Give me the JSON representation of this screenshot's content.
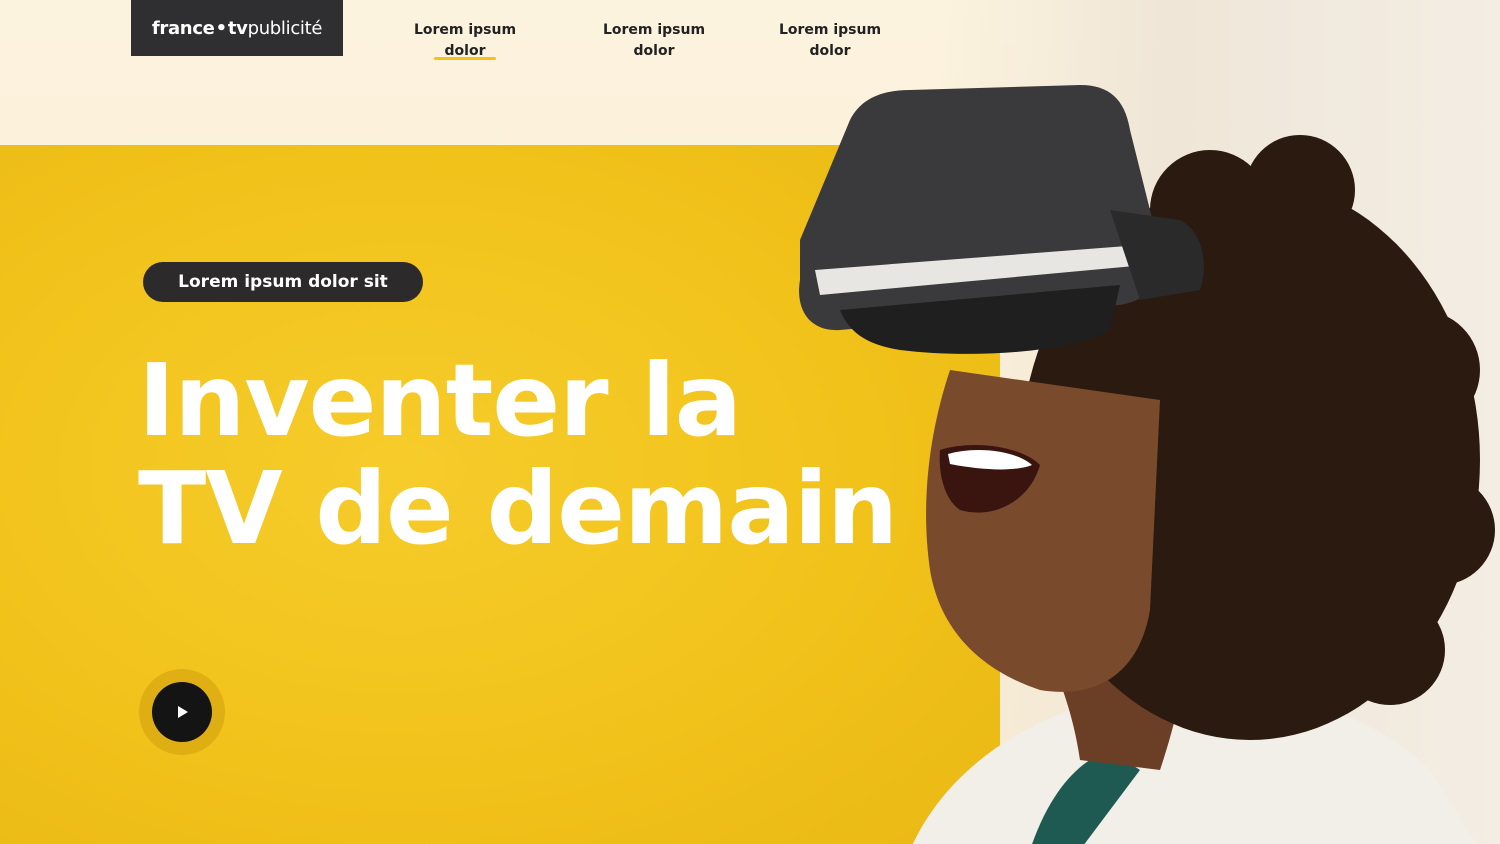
{
  "brand": {
    "logo_text_bold": "france",
    "logo_dot": "•",
    "logo_text_tv": "tv",
    "logo_text_light": "publicité"
  },
  "nav": {
    "items": [
      {
        "line1": "Lorem ipsum",
        "line2": "dolor",
        "active": true
      },
      {
        "line1": "Lorem ipsum",
        "line2": "dolor",
        "active": false
      },
      {
        "line1": "Lorem ipsum",
        "line2": "dolor",
        "active": false
      }
    ]
  },
  "hero": {
    "tag": "Lorem ipsum dolor sit",
    "headline_line1": "Inventer la",
    "headline_line2": "TV de demain"
  },
  "icons": {
    "play": "play-icon"
  },
  "colors": {
    "accent_yellow": "#f2c31a",
    "dark": "#2f2f31",
    "background_cream": "#fbf1dc"
  }
}
